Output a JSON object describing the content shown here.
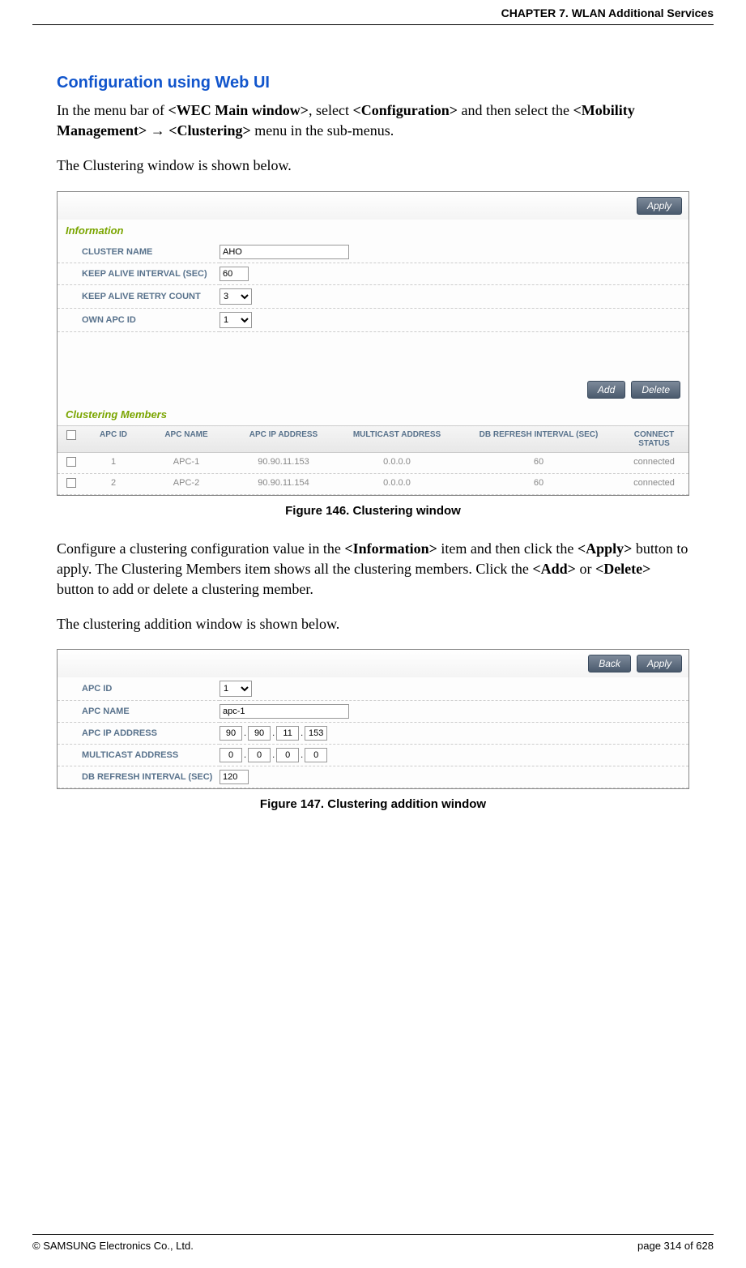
{
  "header": {
    "chapter": "CHAPTER 7. WLAN Additional Services"
  },
  "headings": {
    "h1": "Configuration using Web UI"
  },
  "para1": {
    "pre": "In the menu bar of ",
    "b1": "<WEC Main window>",
    "mid1": ", select ",
    "b2": "<Configuration>",
    "mid2": " and then select the ",
    "b3": "<Mobility Management>",
    "arrow": " → ",
    "b4": "<Clustering>",
    "post": " menu in the sub-menus."
  },
  "para2": "The Clustering window is shown below.",
  "fig1": {
    "apply": "Apply",
    "info_title": "Information",
    "labels": {
      "cluster_name": "CLUSTER NAME",
      "keep_alive_interval": "KEEP ALIVE INTERVAL (SEC)",
      "keep_alive_retry": "KEEP ALIVE RETRY COUNT",
      "own_apc_id": "OWN APC ID"
    },
    "values": {
      "cluster_name": "AHO",
      "keep_alive_interval": "60",
      "keep_alive_retry": "3",
      "own_apc_id": "1"
    },
    "add": "Add",
    "delete": "Delete",
    "members_title": "Clustering Members",
    "cols": {
      "apc_id": "APC ID",
      "apc_name": "APC NAME",
      "apc_ip": "APC IP ADDRESS",
      "multicast": "MULTICAST ADDRESS",
      "db_refresh": "DB REFRESH INTERVAL (SEC)",
      "connect": "CONNECT STATUS"
    },
    "rows": [
      {
        "id": "1",
        "name": "APC-1",
        "ip": "90.90.11.153",
        "mc": "0.0.0.0",
        "db": "60",
        "cs": "connected"
      },
      {
        "id": "2",
        "name": "APC-2",
        "ip": "90.90.11.154",
        "mc": "0.0.0.0",
        "db": "60",
        "cs": "connected"
      }
    ]
  },
  "caption1": "Figure 146. Clustering window",
  "para3": {
    "pre": "Configure a clustering configuration value in the ",
    "b1": "<Information>",
    "mid1": " item and then click the ",
    "b2": "<Apply>",
    "mid2": " button to apply. The Clustering Members item shows all the clustering members. Click the ",
    "b3": "<Add>",
    "mid3": " or ",
    "b4": "<Delete>",
    "post": " button to add or delete a clustering member."
  },
  "para4": "The clustering addition window is shown below.",
  "fig2": {
    "back": "Back",
    "apply": "Apply",
    "labels": {
      "apc_id": "APC ID",
      "apc_name": "APC NAME",
      "apc_ip": "APC IP ADDRESS",
      "multicast": "MULTICAST ADDRESS",
      "db_refresh": "DB REFRESH INTERVAL (SEC)"
    },
    "values": {
      "apc_id": "1",
      "apc_name": "apc-1",
      "ip": [
        "90",
        "90",
        "11",
        "153"
      ],
      "mc": [
        "0",
        "0",
        "0",
        "0"
      ],
      "db_refresh": "120"
    }
  },
  "caption2": "Figure 147. Clustering addition window",
  "footer": {
    "copyright": "© SAMSUNG Electronics Co., Ltd.",
    "page": "page 314 of 628"
  }
}
